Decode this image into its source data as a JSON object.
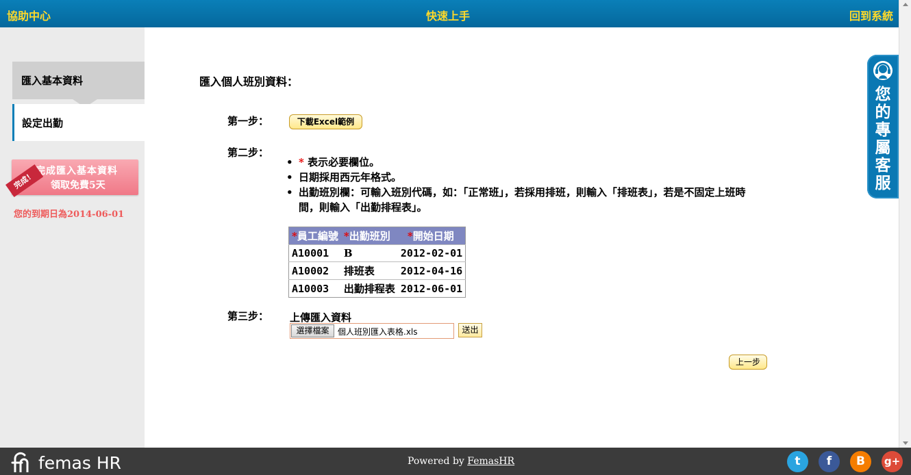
{
  "header": {
    "help_center": "協助中心",
    "quick_start": "快速上手",
    "back_to_system": "回到系統"
  },
  "sidebar": {
    "items": [
      {
        "label": "匯入基本資料"
      },
      {
        "label": "設定出勤"
      }
    ],
    "promo": {
      "ribbon": "完成！",
      "line1": "完成匯入基本資料",
      "line2": "領取免費5天"
    },
    "expiry": "您的到期日為2014-06-01"
  },
  "main": {
    "title": "匯入個人班別資料：",
    "step1": {
      "label": "第一步：",
      "button": "下載Excel範例"
    },
    "step2": {
      "label": "第二步：",
      "rules": [
        {
          "marker": "*",
          "text": " 表示必要欄位。"
        },
        {
          "marker": "",
          "text": "日期採用西元年格式。"
        },
        {
          "marker": "",
          "text": "出勤班別欄：可輸入班別代碼，如：「正常班」，若採用排班，則輸入「排班表」，若是不固定上班時間，則輸入「出勤排程表」。"
        }
      ],
      "table": {
        "headers": [
          {
            "marker": "*",
            "text": "員工編號"
          },
          {
            "marker": "*",
            "text": "出勤班別"
          },
          {
            "marker": "*",
            "text": "開始日期"
          }
        ],
        "rows": [
          [
            "A10001",
            "B",
            "2012-02-01"
          ],
          [
            "A10002",
            "排班表",
            "2012-04-16"
          ],
          [
            "A10003",
            "出勤排程表",
            "2012-06-01"
          ]
        ]
      }
    },
    "step3": {
      "label": "第三步：",
      "upload_label": "上傳匯入資料",
      "choose_file": "選擇檔案",
      "file_name": "個人班別匯入表格.xls",
      "submit": "送出"
    },
    "back": "上一步"
  },
  "cs_tab": {
    "text": [
      "您",
      "的",
      "專",
      "屬",
      "客",
      "服"
    ]
  },
  "footer": {
    "logo_text": "femas HR",
    "powered_prefix": "Powered by ",
    "powered_link": "FemasHR",
    "social": [
      {
        "name": "twitter",
        "glyph": "t",
        "color": "#2aa4e0"
      },
      {
        "name": "facebook",
        "glyph": "f",
        "color": "#3b5998"
      },
      {
        "name": "blogger",
        "glyph": "B",
        "color": "#f57d00"
      },
      {
        "name": "google-plus",
        "glyph": "g+",
        "color": "#dd4b39"
      }
    ]
  }
}
